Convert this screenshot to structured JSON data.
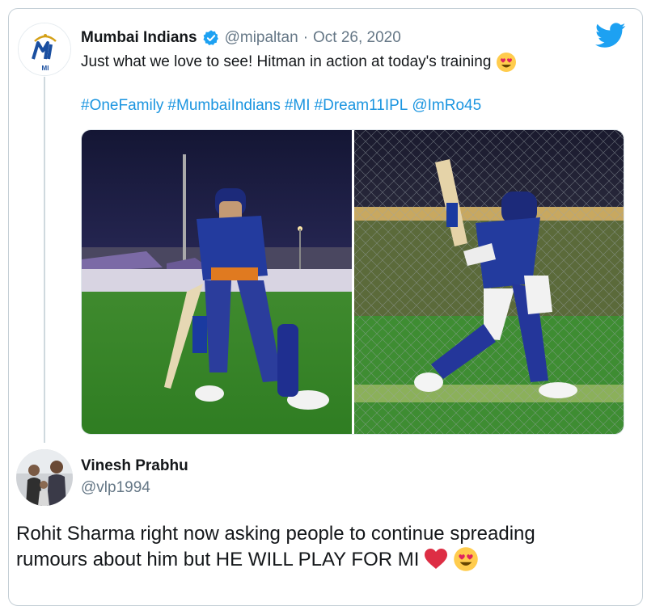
{
  "quoted_tweet": {
    "author_name": "Mumbai Indians",
    "handle": "@mipaltan",
    "separator": "·",
    "date": "Oct 26, 2020",
    "text": "Just what we love to see! Hitman in action at today's training",
    "text_emoji": "heart-eyes-emoji",
    "hashtags": [
      "#OneFamily",
      "#MumbaiIndians",
      "#MI",
      "#Dream11IPL",
      "@ImRo45"
    ],
    "logo_text": "MI"
  },
  "reply": {
    "author_name": "Vinesh Prabhu",
    "handle": "@vlp1994",
    "text_line1": "Rohit Sharma right now asking people to continue spreading",
    "text_line2": "rumours about him but HE WILL PLAY FOR MI",
    "emojis": [
      "red-heart-emoji",
      "heart-eyes-emoji"
    ]
  },
  "colors": {
    "link": "#1b95e0",
    "secondary": "#657786",
    "twitter_blue": "#1da1f2",
    "mi_blue": "#004ba0"
  }
}
